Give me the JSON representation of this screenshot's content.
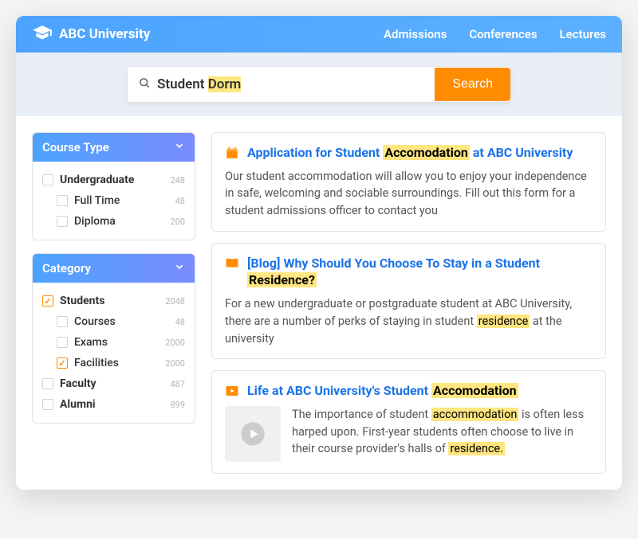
{
  "brand": {
    "name": "ABC University"
  },
  "nav": {
    "items": [
      "Admissions",
      "Conferences",
      "Lectures"
    ]
  },
  "search": {
    "query_pre": "Student ",
    "query_hl": "Dorm",
    "button": "Search"
  },
  "sidebar": {
    "panels": [
      {
        "title": "Course Type",
        "items": [
          {
            "label": "Undergraduate",
            "count": "248",
            "checked": false,
            "bold": true,
            "sub": false
          },
          {
            "label": "Full Time",
            "count": "48",
            "checked": false,
            "bold": false,
            "sub": true
          },
          {
            "label": "Diploma",
            "count": "200",
            "checked": false,
            "bold": false,
            "sub": true
          }
        ]
      },
      {
        "title": "Category",
        "items": [
          {
            "label": "Students",
            "count": "2048",
            "checked": true,
            "bold": true,
            "sub": false
          },
          {
            "label": "Courses",
            "count": "48",
            "checked": false,
            "bold": false,
            "sub": true
          },
          {
            "label": "Exams",
            "count": "2000",
            "checked": false,
            "bold": false,
            "sub": true
          },
          {
            "label": "Facilities",
            "count": "2000",
            "checked": true,
            "bold": false,
            "sub": true
          },
          {
            "label": "Faculty",
            "count": "487",
            "checked": false,
            "bold": true,
            "sub": false
          },
          {
            "label": "Alumni",
            "count": "899",
            "checked": false,
            "bold": true,
            "sub": false
          }
        ]
      }
    ]
  },
  "results": [
    {
      "icon": "calendar",
      "title_parts": [
        {
          "t": "Application for Student ",
          "hl": false
        },
        {
          "t": "Accomodation",
          "hl": true
        },
        {
          "t": " at ABC University",
          "hl": false
        }
      ],
      "body_parts": [
        {
          "t": "Our student accommodation will allow you to enjoy your independence in safe, welcoming and sociable surroundings. Fill out this form for a student admissions officer to contact you",
          "hl": false
        }
      ],
      "thumb": false
    },
    {
      "icon": "book",
      "title_parts": [
        {
          "t": "[Blog] Why Should You Choose To Stay in a Student ",
          "hl": false
        },
        {
          "t": "Residence?",
          "hl": true
        }
      ],
      "body_parts": [
        {
          "t": "For a new undergraduate or postgraduate student at ABC University, there are a number of perks of staying in student ",
          "hl": false
        },
        {
          "t": "residence",
          "hl": true
        },
        {
          "t": " at the university",
          "hl": false
        }
      ],
      "thumb": false
    },
    {
      "icon": "video",
      "title_parts": [
        {
          "t": "Life at ABC University's Student ",
          "hl": false
        },
        {
          "t": "Accomodation",
          "hl": true
        }
      ],
      "body_parts": [
        {
          "t": "The importance of student ",
          "hl": false
        },
        {
          "t": "accommodation",
          "hl": true
        },
        {
          "t": " is often less harped upon. First-year students often choose to live in their course provider's halls of ",
          "hl": false
        },
        {
          "t": "residence.",
          "hl": true
        }
      ],
      "thumb": true
    }
  ]
}
